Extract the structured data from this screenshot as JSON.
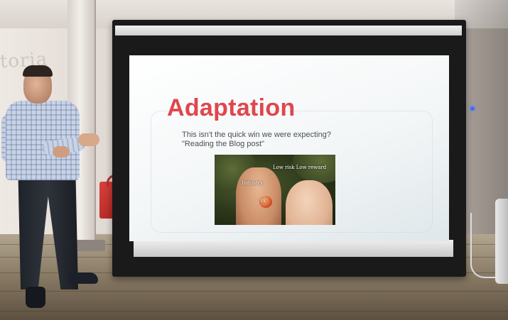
{
  "slide": {
    "title": "Adaptation",
    "subtitle_line1": "This isn't the quick win we were expecting?",
    "subtitle_line2": "\"Reading the Blog post\"",
    "title_color": "#e0464d",
    "image_labels": {
      "top": "Low risk Low reward",
      "left": "Industry",
      "apple": "Ex"
    }
  },
  "wall_sign": {
    "text": "toria"
  }
}
